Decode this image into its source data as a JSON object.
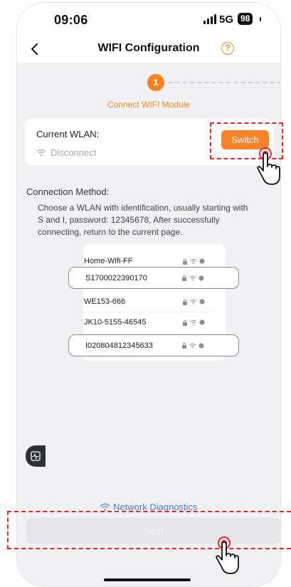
{
  "status_bar": {
    "time": "09:06",
    "network": "5G",
    "battery": "98"
  },
  "header": {
    "title": "WIFI Configuration",
    "help_glyph": "?"
  },
  "stepper": {
    "step_number": "1",
    "step_label": "Connect WIFI Module"
  },
  "current_wlan": {
    "label": "Current WLAN:",
    "state": "Disconnect",
    "switch_label": "Switch"
  },
  "connection_method": {
    "title": "Connection Method:",
    "description": "Choose a WLAN with identification, usually starting with S and I, password: 12345678, After successfully connecting, return to the current page."
  },
  "wifi_list": [
    {
      "name": "Home-Wifi-FF",
      "highlighted": false
    },
    {
      "name": "S1700022390170",
      "highlighted": true
    },
    {
      "name": "WE153-666",
      "highlighted": false
    },
    {
      "name": "JK10-5155-46545",
      "highlighted": false
    },
    {
      "name": "I020804812345633",
      "highlighted": true
    }
  ],
  "footer": {
    "diagnostics_label": "Network Diagnostics",
    "next_label": "Next"
  },
  "colors": {
    "accent": "#f6832a",
    "highlight": "#e2262a",
    "link": "#4a80c8"
  },
  "icons": [
    "back-arrow-icon",
    "help-icon",
    "wifi-icon",
    "lock-icon",
    "info-icon",
    "monitor-icon",
    "tap-hand-icon"
  ]
}
